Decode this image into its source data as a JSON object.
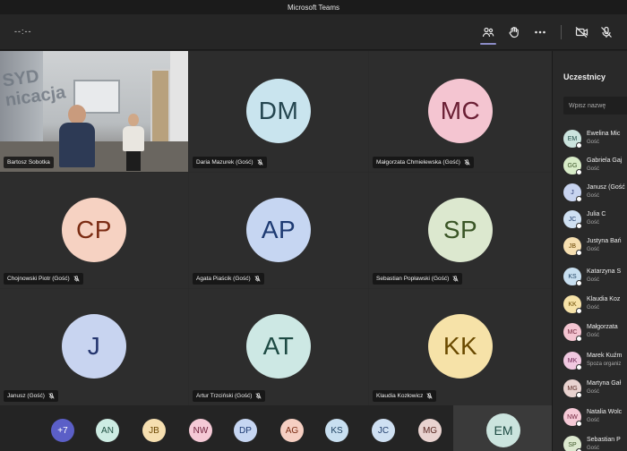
{
  "window": {
    "title": "Microsoft Teams"
  },
  "toolbar": {
    "timer": "--:--",
    "icons": [
      "people-icon",
      "raise-hand-icon",
      "more-icon",
      "camera-off-icon",
      "mic-off-icon"
    ]
  },
  "tiles": [
    {
      "name": "Bartosz Sobotka",
      "initials": "",
      "video": true,
      "muted": false,
      "wall_text": "SYD\nnicacja"
    },
    {
      "name": "Daria Mazurek (Gość)",
      "initials": "DM",
      "bg": "#c9e4ee",
      "fg": "#24454f",
      "muted": true
    },
    {
      "name": "Małgorzata Chmielewska (Gość)",
      "initials": "MC",
      "bg": "#f4c5d1",
      "fg": "#6a1f34",
      "muted": true
    },
    {
      "name": "Chojnowski Piotr (Gość)",
      "initials": "CP",
      "bg": "#f6d2c2",
      "fg": "#7a2b12",
      "muted": true
    },
    {
      "name": "Agata Piaścik (Gość)",
      "initials": "AP",
      "bg": "#c6d6f2",
      "fg": "#1d3a72",
      "muted": true
    },
    {
      "name": "Sebastian Popławski (Gość)",
      "initials": "SP",
      "bg": "#dce8cf",
      "fg": "#3a5526",
      "muted": true
    },
    {
      "name": "Janusz (Gość)",
      "initials": "J",
      "bg": "#c8d4f0",
      "fg": "#24356e",
      "muted": true
    },
    {
      "name": "Artur Trzciński (Gość)",
      "initials": "AT",
      "bg": "#cde8e4",
      "fg": "#1d4a43",
      "muted": true
    },
    {
      "name": "Klaudia Kozłowicz",
      "initials": "KK",
      "bg": "#f6e2a8",
      "fg": "#6a4a00",
      "muted": true
    }
  ],
  "strip": [
    {
      "initials": "+7",
      "bg": "#5b5fc7",
      "fg": "#ffffff"
    },
    {
      "initials": "AN",
      "bg": "#cdece3",
      "fg": "#1d4e40"
    },
    {
      "initials": "JB",
      "bg": "#f6dfb0",
      "fg": "#6a4500"
    },
    {
      "initials": "NW",
      "bg": "#f5c9d6",
      "fg": "#6e1f3a"
    },
    {
      "initials": "DP",
      "bg": "#c6d6f2",
      "fg": "#1d3a72"
    },
    {
      "initials": "AG",
      "bg": "#f6cfc2",
      "fg": "#7a2b12"
    },
    {
      "initials": "KS",
      "bg": "#c8dff0",
      "fg": "#1d4060"
    },
    {
      "initials": "JC",
      "bg": "#cfe0f2",
      "fg": "#24406e"
    },
    {
      "initials": "MG",
      "bg": "#e9d3d0",
      "fg": "#5a2a24"
    }
  ],
  "self": {
    "initials": "EM",
    "bg": "#cbe4de",
    "fg": "#1d4a43"
  },
  "panel": {
    "title": "Uczestnicy",
    "search_placeholder": "Wpisz nazwę",
    "participants": [
      {
        "initials": "EM",
        "name": "Ewelina Mic",
        "role": "Gość",
        "bg": "#cbe4de",
        "fg": "#1d4a43"
      },
      {
        "initials": "GG",
        "name": "Gabriela Gaj",
        "role": "Gość",
        "bg": "#d8ecc8",
        "fg": "#3a5526"
      },
      {
        "initials": "J",
        "name": "Janusz (Gość",
        "role": "Gość",
        "bg": "#c8d4f0",
        "fg": "#24356e"
      },
      {
        "initials": "JC",
        "name": "Julia C",
        "role": "Gość",
        "bg": "#cfe0f2",
        "fg": "#24406e"
      },
      {
        "initials": "JB",
        "name": "Justyna Bań",
        "role": "Gość",
        "bg": "#f6dfb0",
        "fg": "#6a4500"
      },
      {
        "initials": "KS",
        "name": "Katarzyna S",
        "role": "Gość",
        "bg": "#c8dff0",
        "fg": "#1d4060"
      },
      {
        "initials": "KK",
        "name": "Klaudia Koz",
        "role": "Gość",
        "bg": "#f6e2a8",
        "fg": "#6a4a00"
      },
      {
        "initials": "MC",
        "name": "Małgorzata",
        "role": "Gość",
        "bg": "#f4c5d1",
        "fg": "#6a1f34"
      },
      {
        "initials": "MK",
        "name": "Marek Kuźm",
        "role": "Spoza organiz",
        "bg": "#f0c8e0",
        "fg": "#6a1f4e"
      },
      {
        "initials": "MG",
        "name": "Martyna Gał",
        "role": "Gość",
        "bg": "#e9d3d0",
        "fg": "#5a2a24"
      },
      {
        "initials": "NW",
        "name": "Natalia Wolc",
        "role": "Gość",
        "bg": "#f5c9d6",
        "fg": "#6e1f3a"
      },
      {
        "initials": "SP",
        "name": "Sebastian P",
        "role": "Gość",
        "bg": "#dce8cf",
        "fg": "#3a5526"
      }
    ]
  }
}
